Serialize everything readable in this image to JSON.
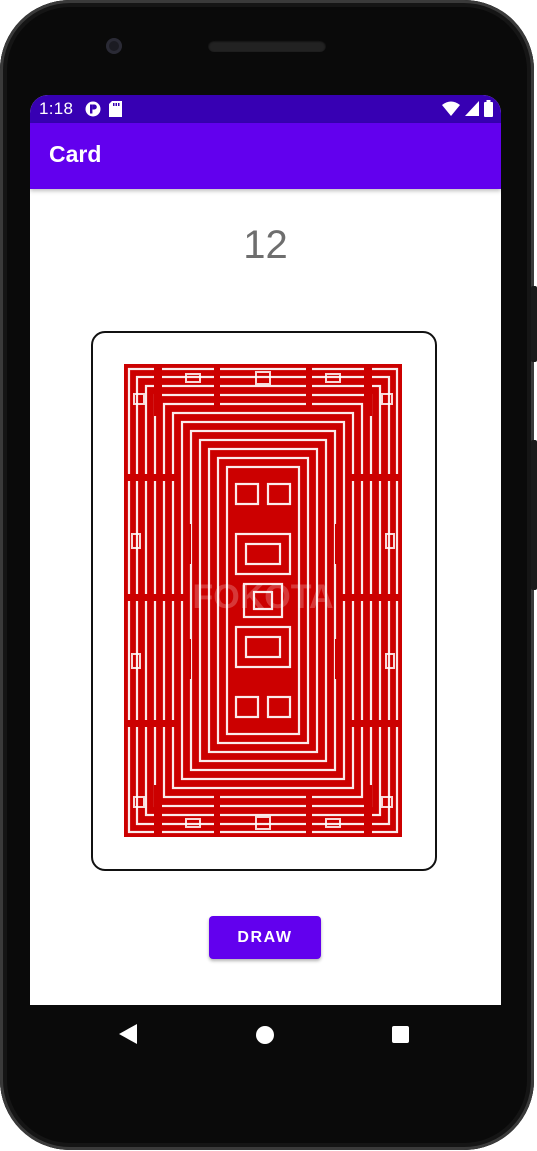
{
  "app": {
    "title": "Card"
  },
  "status_bar": {
    "time": "1:18",
    "left_icons": [
      "data-saver-icon",
      "sd-card-icon"
    ],
    "right_icons": [
      "wifi-icon",
      "cell-signal-icon",
      "battery-icon"
    ]
  },
  "main": {
    "count": "12",
    "card": {
      "face": "back",
      "pattern_color": "#cc0000",
      "watermark": "FOKOTA"
    },
    "draw_button_label": "DRAW"
  },
  "nav_bar": {
    "buttons": [
      "back-icon",
      "home-icon",
      "recents-icon"
    ]
  },
  "colors": {
    "status_bar": "#3700b3",
    "app_bar": "#6200ee",
    "accent": "#6200ee",
    "card_back": "#cc0000"
  }
}
